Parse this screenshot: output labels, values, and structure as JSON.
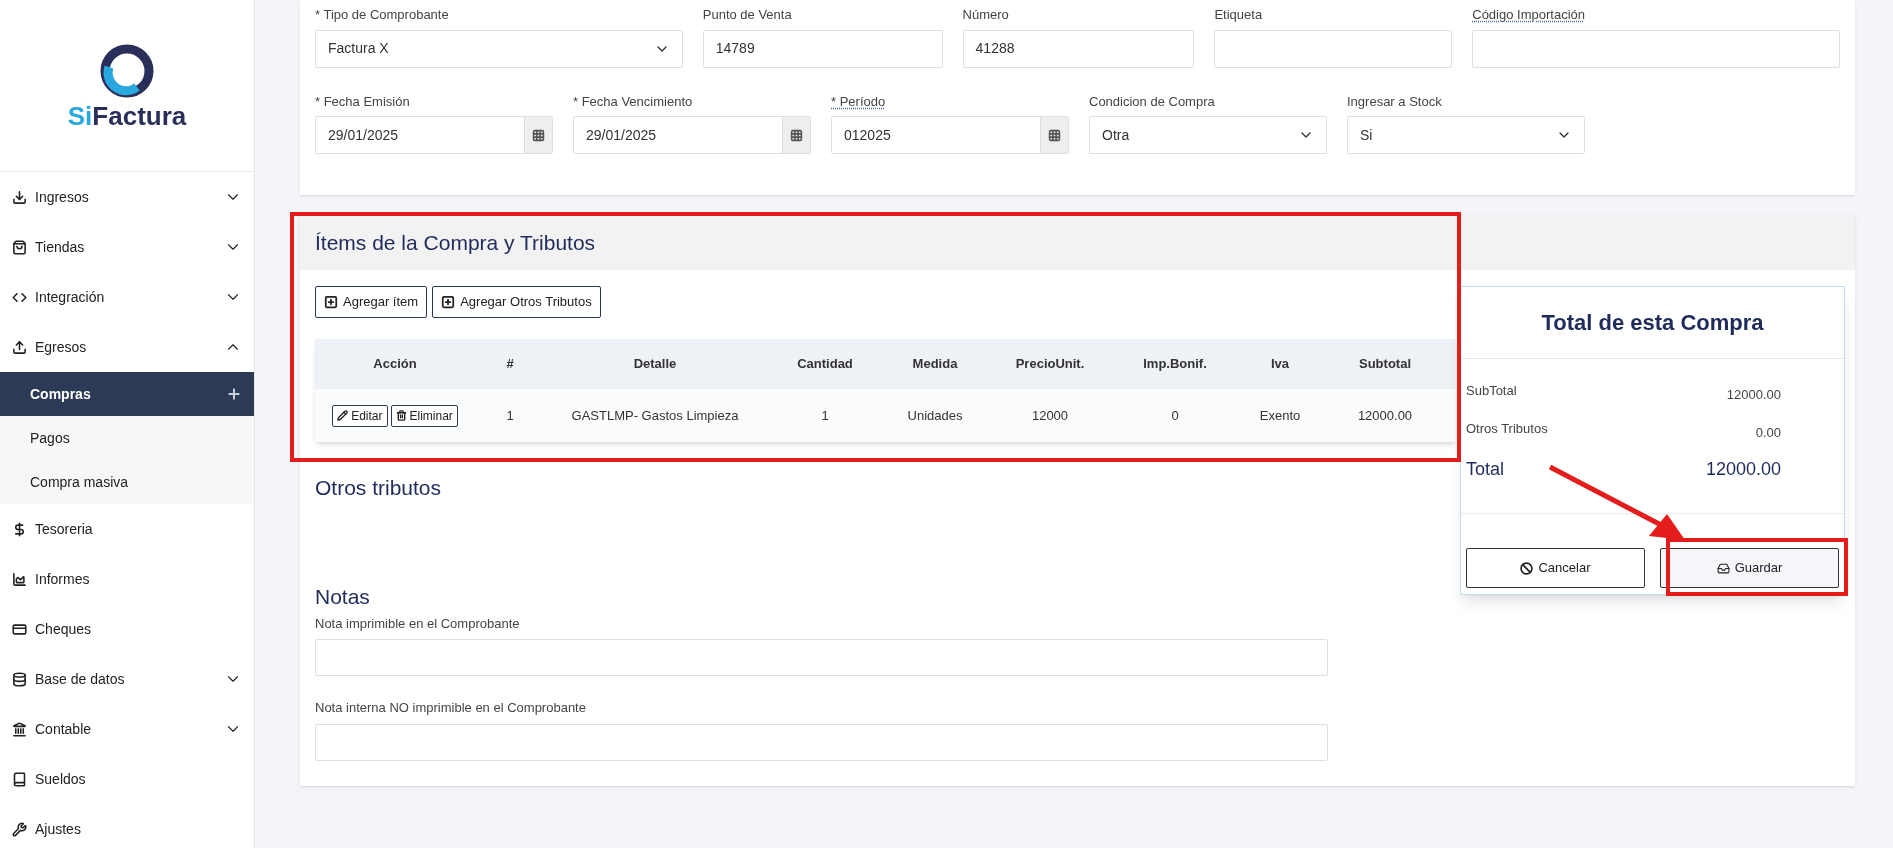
{
  "sidebar": {
    "logo": {
      "text_1": "Si",
      "text_2": "Factura"
    },
    "items": [
      {
        "label": "Ingresos",
        "kind": "group",
        "expanded": false
      },
      {
        "label": "Tiendas",
        "kind": "group",
        "expanded": false
      },
      {
        "label": "Integración",
        "kind": "group",
        "expanded": false
      },
      {
        "label": "Egresos",
        "kind": "group",
        "expanded": true,
        "children": [
          {
            "label": "Compras",
            "selected": true
          },
          {
            "label": "Pagos",
            "selected": false
          },
          {
            "label": "Compra masiva",
            "selected": false
          }
        ]
      },
      {
        "label": "Tesoreria",
        "kind": "link"
      },
      {
        "label": "Informes",
        "kind": "link"
      },
      {
        "label": "Cheques",
        "kind": "link"
      },
      {
        "label": "Base de datos",
        "kind": "group",
        "expanded": false
      },
      {
        "label": "Contable",
        "kind": "group",
        "expanded": false
      },
      {
        "label": "Sueldos",
        "kind": "link"
      },
      {
        "label": "Ajustes",
        "kind": "link"
      }
    ]
  },
  "header_form": {
    "rows": [
      [
        {
          "label": "* Tipo de Comprobante",
          "kind": "select",
          "value": "Factura X",
          "tooltip": false
        },
        {
          "label": "Punto de Venta",
          "kind": "text",
          "value": "14789",
          "tooltip": false
        },
        {
          "label": "Número",
          "kind": "text",
          "value": "41288",
          "tooltip": false
        },
        {
          "label": "Etiqueta",
          "kind": "text",
          "tooltip": false
        },
        {
          "label": "Código Importación",
          "kind": "text",
          "tooltip": true
        }
      ],
      [
        {
          "label": "* Fecha Emisión",
          "kind": "date",
          "value": "29/01/2025",
          "tooltip": false
        },
        {
          "label": "* Fecha Vencimiento",
          "kind": "date",
          "value": "29/01/2025",
          "tooltip": false
        },
        {
          "label": "* Período",
          "kind": "date",
          "value": "012025",
          "tooltip": true
        },
        {
          "label": "Condicion de Compra",
          "kind": "select",
          "value": "Otra",
          "tooltip": false
        },
        {
          "label": "Ingresar a Stock",
          "kind": "select",
          "value": "Si",
          "tooltip": false
        }
      ]
    ]
  },
  "items_section": {
    "title": "Ítems de la Compra y Tributos",
    "buttons": [
      "Agregar ítem",
      "Agregar Otros Tributos"
    ],
    "table": {
      "columns": [
        "Acción",
        "#",
        "Detalle",
        "Cantidad",
        "Medida",
        "PrecioUnit.",
        "Imp.Bonif.",
        "Iva",
        "Subtotal"
      ],
      "rows": [
        {
          "cells": [
            {
              "buttons": [
                "Editar",
                "Eliminar"
              ]
            },
            "1",
            "GASTLMP- Gastos Limpieza",
            "1",
            "Unidades",
            "12000",
            "0",
            "Exento",
            "12000.00"
          ]
        }
      ]
    }
  },
  "otros_tributos": {
    "title": "Otros tributos"
  },
  "notas": {
    "title": "Notas",
    "fields": [
      {
        "label": "Nota imprimible en el Comprobante"
      },
      {
        "label": "Nota interna NO imprimible en el Comprobante"
      }
    ]
  },
  "totals": {
    "title": "Total de esta Compra",
    "rows": [
      {
        "label": "SubTotal",
        "value": "12000.00",
        "kind": "normal"
      },
      {
        "label": "Otros Tributos",
        "value": "0.00",
        "kind": "normal"
      },
      {
        "label": "Total",
        "value": "12000.00",
        "kind": "total"
      }
    ],
    "buttons": [
      "Cancelar",
      "Guardar"
    ]
  }
}
